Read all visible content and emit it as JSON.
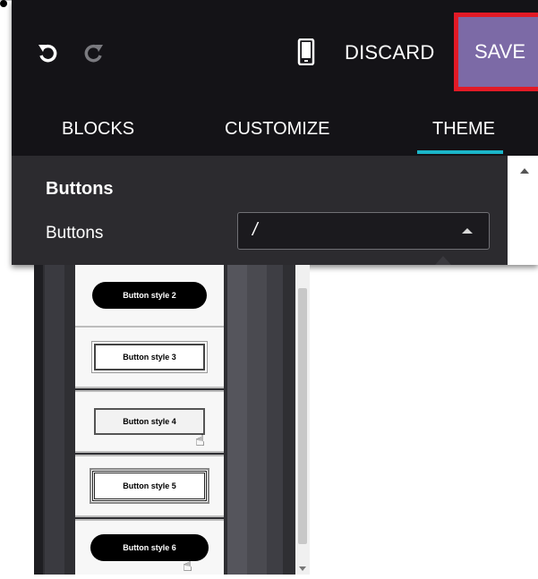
{
  "toolbar": {
    "undo_icon": "undo-icon",
    "redo_icon": "redo-icon",
    "mobile_icon": "mobile-preview-icon",
    "discard_label": "DISCARD",
    "save_label": "SAVE",
    "save_color": "#7c6aa6",
    "highlight_color": "#e21a26"
  },
  "tabs": [
    {
      "label": "BLOCKS"
    },
    {
      "label": "CUSTOMIZE"
    },
    {
      "label": "THEME",
      "active": true
    }
  ],
  "accent_color": "#1bb6c9",
  "section": {
    "title": "Buttons",
    "field_label": "Buttons",
    "select_value": "/"
  },
  "dropdown": {
    "options": [
      {
        "label": "Button style 2"
      },
      {
        "label": "Button style 3"
      },
      {
        "label": "Button style 4"
      },
      {
        "label": "Button style 5"
      },
      {
        "label": "Button style 6"
      }
    ]
  }
}
